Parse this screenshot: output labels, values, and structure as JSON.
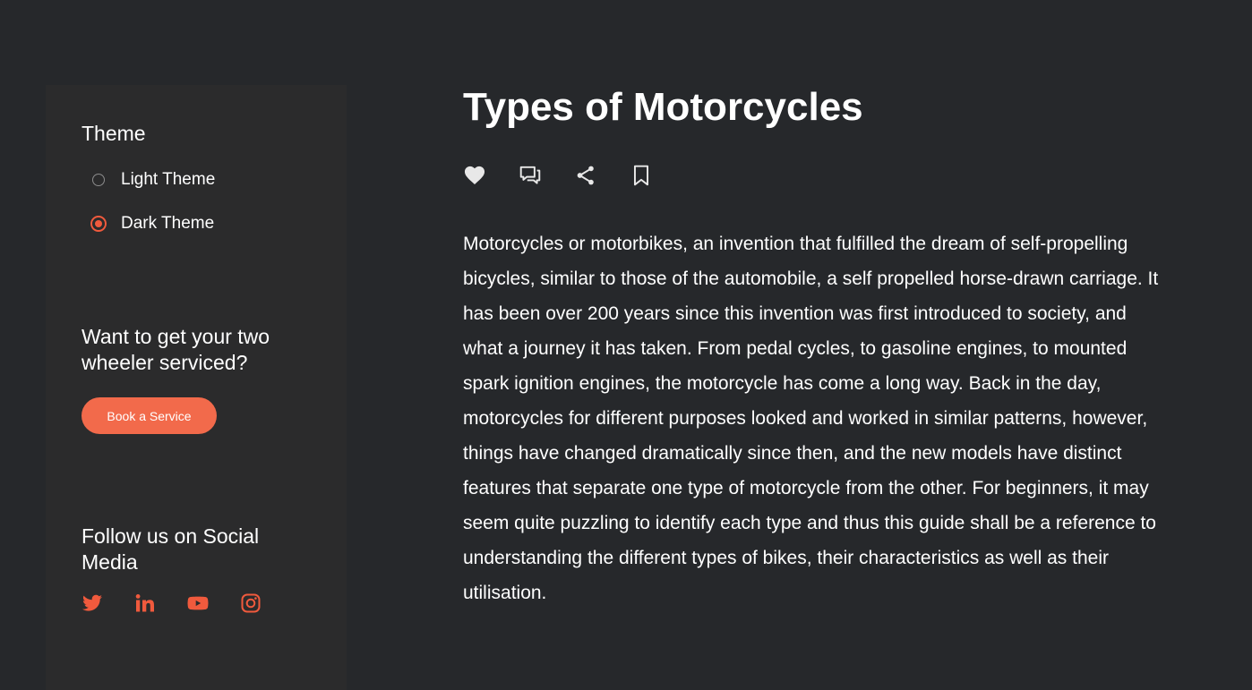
{
  "sidebar": {
    "theme": {
      "heading": "Theme",
      "options": [
        {
          "label": "Light Theme",
          "selected": false
        },
        {
          "label": "Dark Theme",
          "selected": true
        }
      ]
    },
    "service": {
      "heading": "Want to get your two wheeler serviced?",
      "button_label": "Book a Service"
    },
    "social": {
      "heading": "Follow us on Social Media",
      "icons": [
        "twitter-icon",
        "linkedin-icon",
        "youtube-icon",
        "instagram-icon"
      ]
    }
  },
  "article": {
    "title": "Types of Motorcycles",
    "actions": [
      "heart-icon",
      "comment-icon",
      "share-icon",
      "bookmark-icon"
    ],
    "body": "Motorcycles or motorbikes, an invention that fulfilled the dream of self-propelling bicycles, similar to those of the automobile, a self propelled horse-drawn carriage. It has been over 200 years since this invention was first introduced to society, and what a journey it has taken. From pedal cycles, to gasoline engines, to mounted spark ignition engines, the motorcycle has come a long way. Back in the day, motorcycles for different purposes looked and worked in similar patterns, however, things have changed dramatically since then, and the new models have distinct features that separate one type of motorcycle from the other. For beginners, it may seem quite puzzling to identify each type and thus this guide shall be a reference to understanding the different types of bikes, their characteristics as well as their utilisation."
  },
  "colors": {
    "background": "#26282b",
    "sidebar": "#2b2b2c",
    "accent": "#f05a3d",
    "button": "#f26a4b",
    "text": "#ffffff"
  }
}
